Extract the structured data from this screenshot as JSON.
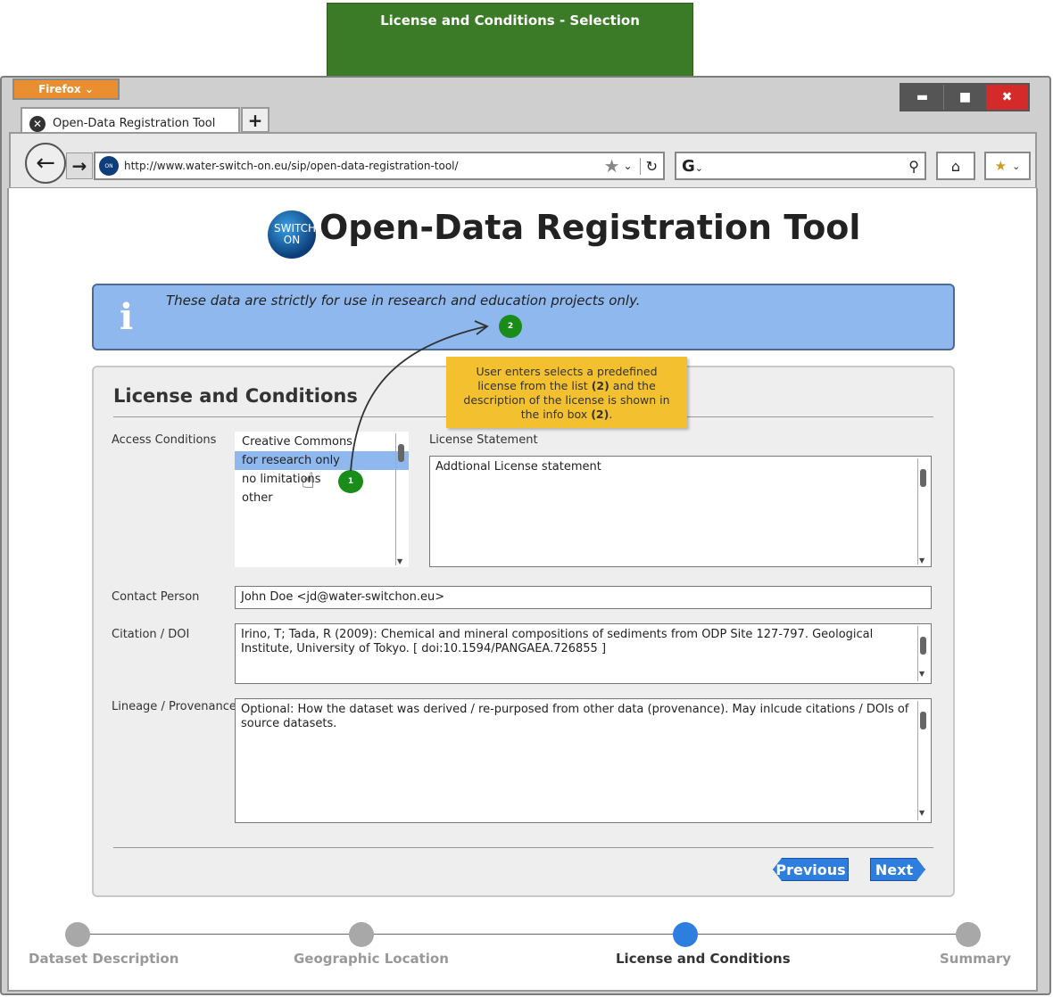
{
  "banner": {
    "title": "License and Conditions - Selection"
  },
  "browser": {
    "menu_button": "Firefox",
    "tab_title": "Open-Data Registration Tool",
    "url": "http://www.water-switch-on.eu/sip/open-data-registration-tool/",
    "search_engine_label": "G",
    "window_controls": [
      "minimize",
      "maximize",
      "close"
    ]
  },
  "page": {
    "logo_text": "SWITCH ON",
    "title": "Open-Data Registration Tool",
    "info_message": "These data are strictly for use in research and education projects only.",
    "section_title": "License and Conditions"
  },
  "form": {
    "access_conditions_label": "Access Conditions",
    "access_options": [
      "Creative Commons",
      "for research only",
      "no limitations",
      "other"
    ],
    "access_selected": "for research only",
    "license_statement_label": "License Statement",
    "license_statement_value": "Addtional License statement",
    "contact_person_label": "Contact Person",
    "contact_person_value": "John Doe <jd@water-switchon.eu>",
    "citation_label": "Citation / DOI",
    "citation_value": "Irino, T; Tada, R (2009): Chemical and mineral compositions of sediments from ODP Site 127-797. Geological Institute, University of Tokyo. [ doi:10.1594/PANGAEA.726855 ]",
    "lineage_label": "Lineage / Provenance",
    "lineage_value": "Optional: How the dataset was derived / re-purposed from other data (provenance). May inlcude citations / DOIs of source datasets.",
    "previous_label": "Previous",
    "next_label": "Next"
  },
  "annotation": {
    "note_text_1": "User enters selects a predefined license from the list ",
    "note_bold_1": "(2)",
    "note_text_2": " and the description of the license is shown in the info box ",
    "note_bold_2": "(2)",
    "note_text_3": ".",
    "marker_1": "1",
    "marker_2": "2"
  },
  "steps": [
    {
      "label": "Dataset Description",
      "active": false
    },
    {
      "label": "Geographic Location",
      "active": false
    },
    {
      "label": "License and Conditions",
      "active": true
    },
    {
      "label": "Summary",
      "active": false
    }
  ],
  "colors": {
    "banner": "#3b7a26",
    "info_box": "#8fb8ee",
    "accent": "#2e7ee0",
    "note": "#f3c12f",
    "marker": "#1a8c1a"
  }
}
